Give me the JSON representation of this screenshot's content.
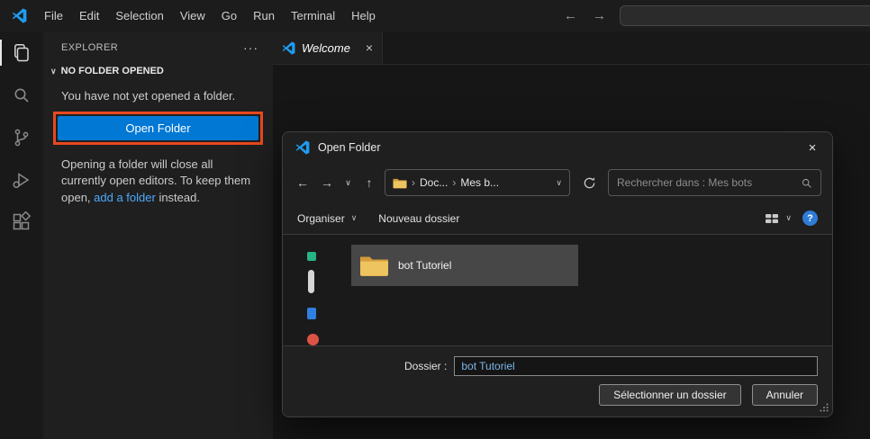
{
  "titlebar": {
    "menus": [
      "File",
      "Edit",
      "Selection",
      "View",
      "Go",
      "Run",
      "Terminal",
      "Help"
    ]
  },
  "icons": {
    "back": "←",
    "forward": "→",
    "up": "↑",
    "chevron_down": "∨",
    "chevron_right": "›",
    "close": "×",
    "ellipsis": "···",
    "question": "?"
  },
  "sidebar": {
    "title": "EXPLORER",
    "section_label": "NO FOLDER OPENED",
    "empty_message": "You have not yet opened a folder.",
    "open_folder_button": "Open Folder",
    "note_before_link": "Opening a folder will close all currently open editors. To keep them open, ",
    "note_link": "add a folder",
    "note_after_link": " instead."
  },
  "editor": {
    "tab_label": "Welcome"
  },
  "dialog": {
    "title": "Open Folder",
    "breadcrumbs": [
      "Doc...",
      "Mes b..."
    ],
    "search_placeholder": "Rechercher dans : Mes bots",
    "organize_label": "Organiser",
    "new_folder_label": "Nouveau dossier",
    "folder_item_label": "bot Tutoriel",
    "folder_field_label": "Dossier :",
    "folder_field_value": "bot Tutoriel",
    "select_button_label": "Sélectionner un dossier",
    "cancel_button_label": "Annuler"
  },
  "colors": {
    "accent_blue": "#0078d4",
    "annotation_orange": "#e8491f",
    "link_blue": "#4daafc"
  }
}
